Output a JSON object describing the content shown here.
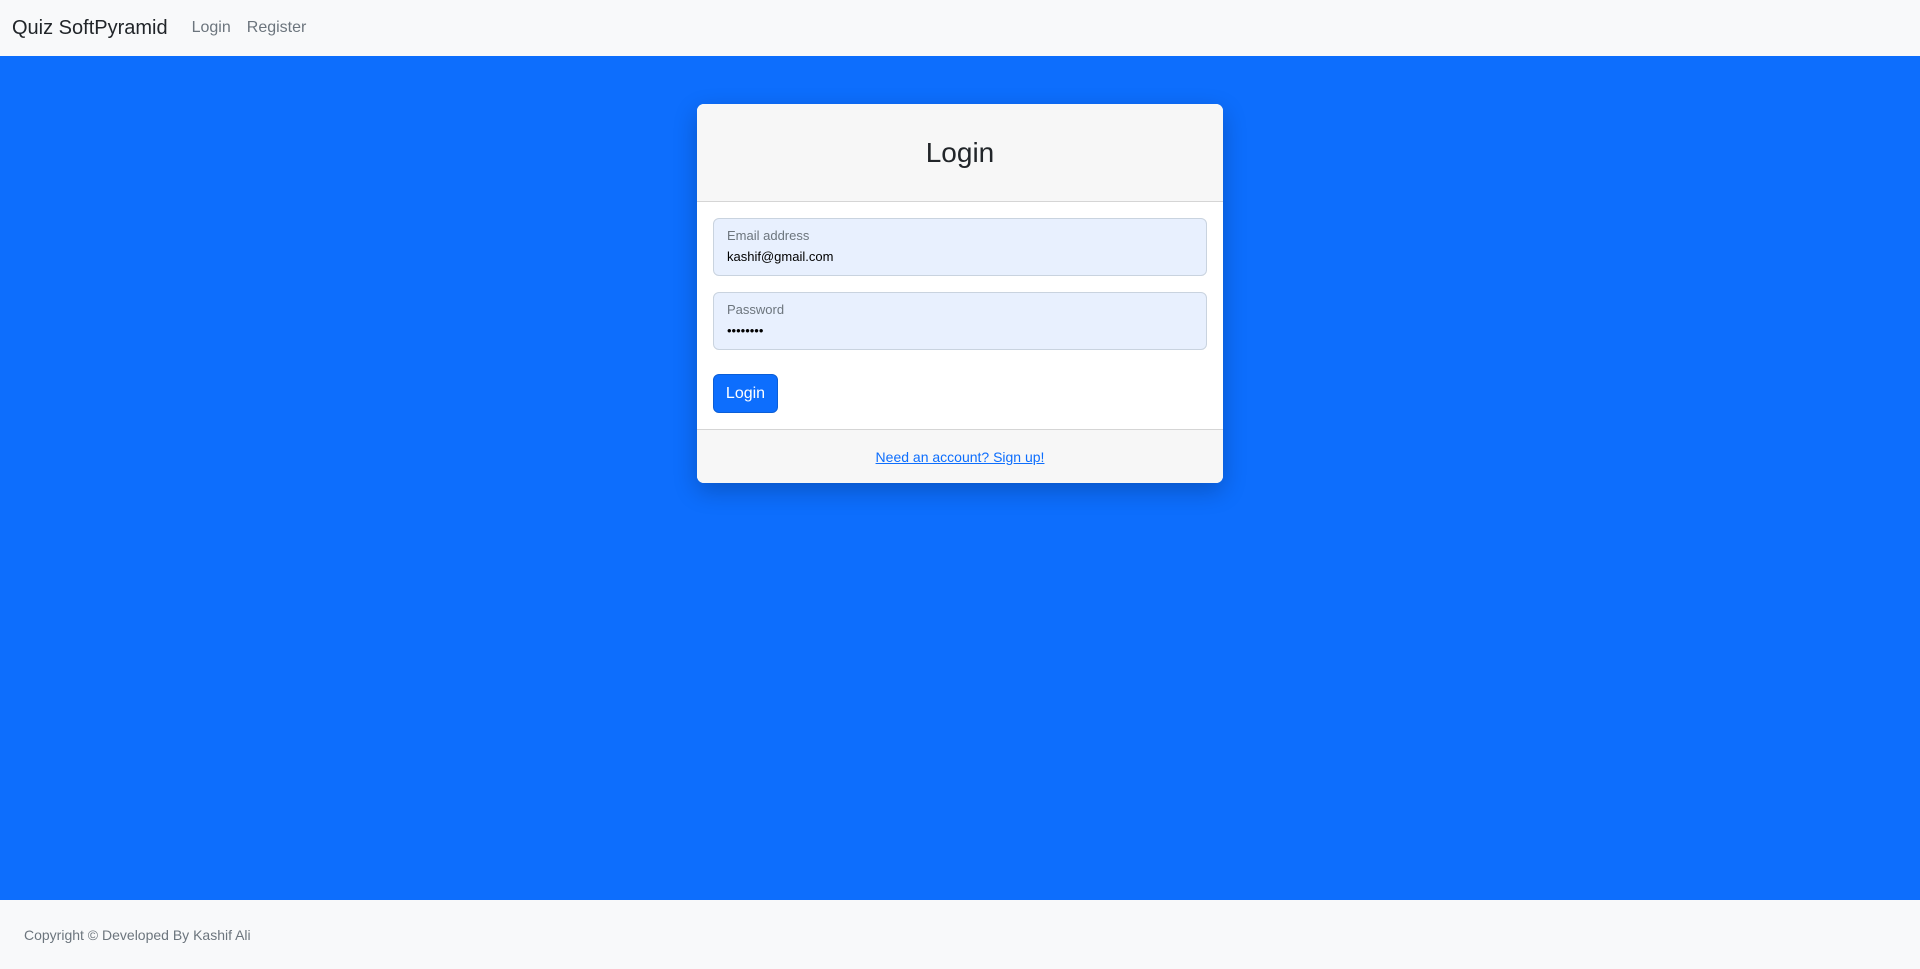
{
  "navbar": {
    "brand": "Quiz SoftPyramid",
    "links": [
      {
        "label": "Login"
      },
      {
        "label": "Register"
      }
    ]
  },
  "login_card": {
    "title": "Login",
    "email": {
      "label": "Email address",
      "value": "kashif@gmail.com",
      "placeholder": "Email address"
    },
    "password": {
      "label": "Password",
      "value": "password",
      "placeholder": "Password"
    },
    "submit_label": "Login",
    "signup_link": "Need an account? Sign up!"
  },
  "footer": {
    "copyright": "Copyright © Developed By Kashif Ali"
  },
  "colors": {
    "primary": "#0d6efd",
    "navbar_bg": "#f8f9fa",
    "input_bg": "#e8f0fe"
  }
}
